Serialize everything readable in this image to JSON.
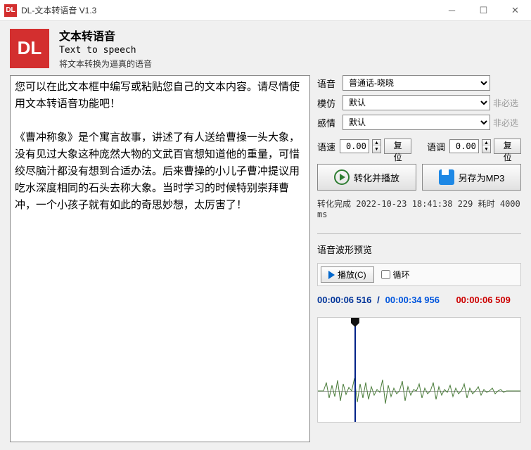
{
  "window": {
    "title": "DL-文本转语音 V1.3",
    "icon": "DL"
  },
  "header": {
    "logo": "DL",
    "title": "文本转语音",
    "sub1": "Text to speech",
    "sub2": "将文本转换为逼真的语音"
  },
  "textContent": "您可以在此文本框中编写或粘贴您自己的文本内容。请尽情使用文本转语音功能吧！\n\n《曹冲称象》是个寓言故事，讲述了有人送给曹操一头大象，没有见过大象这种庞然大物的文武百官想知道他的重量，可惜绞尽脑汁都没有想到合适办法。后来曹操的小儿子曹冲提议用吃水深度相同的石头去称大象。当时学习的时候特别崇拜曹冲，一个小孩子就有如此的奇思妙想，太厉害了！",
  "labels": {
    "voice": "语音",
    "imitate": "模仿",
    "emotion": "感情",
    "speed": "语速",
    "tone": "语调",
    "reset": "复位",
    "optional": "非必选",
    "convertPlay": "转化并播放",
    "saveMp3": "另存为MP3",
    "waveformPreview": "语音波形预览",
    "play": "播放(C)",
    "loop": "循环"
  },
  "selects": {
    "voice": "普通话-晓晓",
    "imitate": "默认",
    "emotion": "默认"
  },
  "nums": {
    "speed": "0.00",
    "tone": "0.00"
  },
  "status": "转化完成 2022-10-23 18:41:38 229 耗时 4000 ms",
  "time": {
    "current": "00:00:06 516",
    "total": "00:00:34 956",
    "mark": "00:00:06 509",
    "sep": "/"
  }
}
